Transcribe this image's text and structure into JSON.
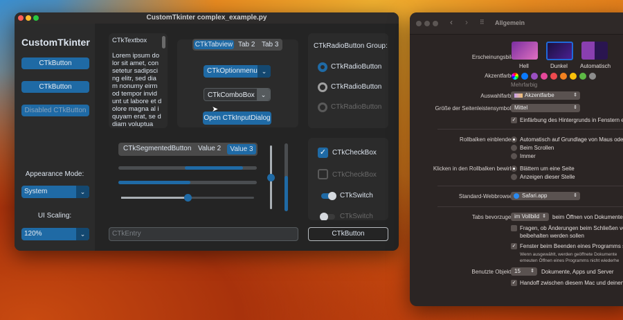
{
  "ctk": {
    "title": "CustomTkinter complex_example.py",
    "logo": "CustomTkinter",
    "sidebar_buttons": [
      "CTkButton",
      "CTkButton",
      "Disabled CTkButton"
    ],
    "appearance_label": "Appearance Mode:",
    "appearance_value": "System",
    "scaling_label": "UI Scaling:",
    "scaling_value": "120%",
    "textbox": {
      "title": "CTkTextbox",
      "body": "Lorem ipsum do lor sit amet, con setetur sadipsci ng elitr, sed dia m nonumy eirm od tempor invid unt ut labore et dolore magna al iquyam erat, se d diam voluptua"
    },
    "tabs": [
      "CTkTabview",
      "Tab 2",
      "Tab 3"
    ],
    "optionmenu": "CTkOptionmenu",
    "combobox": "CTkComboBox",
    "dialog_button": "Open CTkInputDialog",
    "radio_title": "CTkRadioButton Group:",
    "radios": [
      "CTkRadioButton",
      "CTkRadioButton",
      "CTkRadioButton"
    ],
    "segmented": [
      "CTkSegmentedButton",
      "Value 2",
      "Value 3"
    ],
    "progress1": {
      "start": 0.48,
      "end": 0.9
    },
    "progress2": 0.52,
    "slider": 0.5,
    "vslider": 0.5,
    "vprogress": 0.52,
    "checkboxes": [
      "CTkCheckBox",
      "CTkCheckBox"
    ],
    "switches": [
      "CTkSwitch",
      "CTkSwitch"
    ],
    "entry_placeholder": "CTkEntry",
    "bottom_button": "CTkButton",
    "accent": "#1f6aa5"
  },
  "settings": {
    "title": "Allgemein",
    "appearance_label": "Erscheinungsbild:",
    "appearance_options": [
      "Hell",
      "Dunkel",
      "Automatisch"
    ],
    "accent_label": "Akzentfarbe:",
    "accent_colors": [
      "#0a7aff",
      "#9a4fc0",
      "#e5489a",
      "#ee4a4f",
      "#f38120",
      "#f9c10a",
      "#5db945",
      "#8c8c8c"
    ],
    "accent_caption": "Mehrfarbig",
    "highlight_label": "Auswahlfarbe:",
    "highlight_value": "Akzentfarbe",
    "sidebar_size_label": "Größe der Seitenleistensymbole:",
    "sidebar_size_value": "Mittel",
    "tint_check": "Einfärbung des Hintergrunds in Fenstern e",
    "scroll_label": "Rollbalken einblenden:",
    "scroll_options": [
      "Automatisch auf Grundlage von Maus oder",
      "Beim Scrollen",
      "Immer"
    ],
    "click_label": "Klicken in den Rollbalken bewirkt:",
    "click_options": [
      "Blättern um eine Seite",
      "Anzeigen dieser Stelle"
    ],
    "browser_label": "Standard-Webbrowser:",
    "browser_value": "Safari.app",
    "tabs_label": "Tabs bevorzugen:",
    "tabs_value": "im Vollbild",
    "tabs_suffix": "beim Öffnen von Dokumenten",
    "ask_check_1": "Fragen, ob Änderungen beim Schließen vo",
    "ask_check_2": "beibehalten werden sollen",
    "close_check": "Fenster beim Beenden eines Programms sc",
    "close_note_1": "Wenn ausgewählt, werden geöffnete Dokumente",
    "close_note_2": "erneuten Öffnen eines Programms nicht wiederhe",
    "recent_label": "Benutzte Objekte:",
    "recent_value": "15",
    "recent_suffix": "Dokumente, Apps und Server",
    "handoff_check": "Handoff zwischen diesem Mac und deinen"
  }
}
